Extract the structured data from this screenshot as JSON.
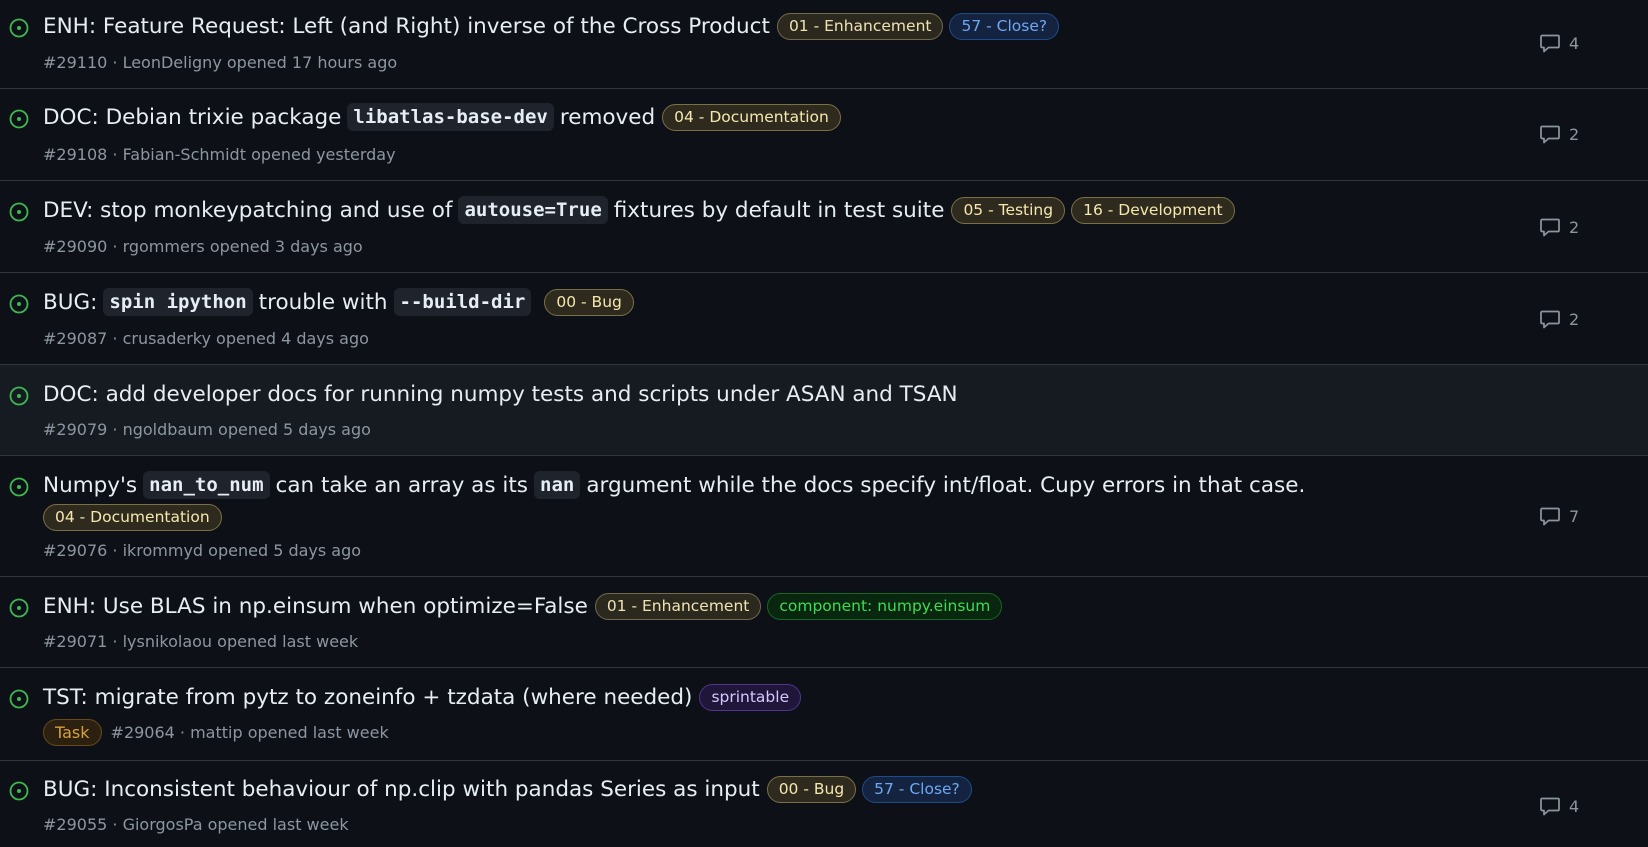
{
  "colors": {
    "background": "#0d1117",
    "open_icon": "#3fb950",
    "text_primary": "#e6edf3",
    "text_muted": "#8d96a0",
    "divider": "#30363d"
  },
  "issues": [
    {
      "title_parts": [
        {
          "text": "ENH: Feature Request: Left (and Right) inverse of the Cross Product",
          "code": false
        }
      ],
      "labels": [
        {
          "text": "01 - Enhancement",
          "style": "enh"
        },
        {
          "text": "57 - Close?",
          "style": "close"
        }
      ],
      "meta": "#29110 · LeonDeligny opened 17 hours ago",
      "comments": "4"
    },
    {
      "title_parts": [
        {
          "text": "DOC: Debian trixie package",
          "code": false
        },
        {
          "text": "libatlas-base-dev",
          "code": true
        },
        {
          "text": "removed",
          "code": false
        }
      ],
      "labels": [
        {
          "text": "04 - Documentation",
          "style": "doc"
        }
      ],
      "meta": "#29108 · Fabian-Schmidt opened yesterday",
      "comments": "2"
    },
    {
      "title_parts": [
        {
          "text": "DEV: stop monkeypatching and use of",
          "code": false
        },
        {
          "text": "autouse=True",
          "code": true
        },
        {
          "text": "fixtures by default in test suite",
          "code": false
        }
      ],
      "labels": [
        {
          "text": "05 - Testing",
          "style": "doc"
        },
        {
          "text": "16 - Development",
          "style": "doc"
        }
      ],
      "meta": "#29090 · rgommers opened 3 days ago",
      "comments": "2"
    },
    {
      "title_parts": [
        {
          "text": "BUG:",
          "code": false
        },
        {
          "text": "spin ipython",
          "code": true
        },
        {
          "text": "trouble with",
          "code": false
        },
        {
          "text": "--build-dir",
          "code": true
        }
      ],
      "labels": [
        {
          "text": "00 - Bug",
          "style": "doc"
        }
      ],
      "meta": "#29087 · crusaderky opened 4 days ago",
      "comments": "2"
    },
    {
      "title_parts": [
        {
          "text": "DOC: add developer docs for running numpy tests and scripts under ASAN and TSAN",
          "code": false
        }
      ],
      "labels": [],
      "meta": "#29079 · ngoldbaum opened 5 days ago",
      "comments": ""
    },
    {
      "title_parts": [
        {
          "text": "Numpy's",
          "code": false
        },
        {
          "text": "nan_to_num",
          "code": true
        },
        {
          "text": "can take an array as its",
          "code": false
        },
        {
          "text": "nan",
          "code": true
        },
        {
          "text": "argument while the docs specify int/float. Cupy errors in that case.",
          "code": false
        }
      ],
      "labels": [],
      "wrapped_labels": [
        {
          "text": "04 - Documentation",
          "style": "doc"
        }
      ],
      "meta": "#29076 · ikrommyd opened 5 days ago",
      "comments": "7"
    },
    {
      "title_parts": [
        {
          "text": "ENH: Use BLAS in np.einsum when optimize=False",
          "code": false
        }
      ],
      "labels": [
        {
          "text": "01 - Enhancement",
          "style": "enh"
        },
        {
          "text": "component: numpy.einsum",
          "style": "green"
        }
      ],
      "meta": "#29071 · lysnikolaou opened last week",
      "comments": ""
    },
    {
      "title_parts": [
        {
          "text": "TST: migrate from pytz to zoneinfo + tzdata (where needed)",
          "code": false
        }
      ],
      "labels": [
        {
          "text": "sprintable",
          "style": "purple"
        }
      ],
      "type_label": "Task",
      "meta": "#29064 · mattip opened last week",
      "comments": ""
    },
    {
      "title_parts": [
        {
          "text": "BUG: Inconsistent behaviour of np.clip with pandas Series as input",
          "code": false
        }
      ],
      "labels": [
        {
          "text": "00 - Bug",
          "style": "doc"
        },
        {
          "text": "57 - Close?",
          "style": "close"
        }
      ],
      "meta": "#29055 · GiorgosPa opened last week",
      "comments": "4"
    }
  ]
}
